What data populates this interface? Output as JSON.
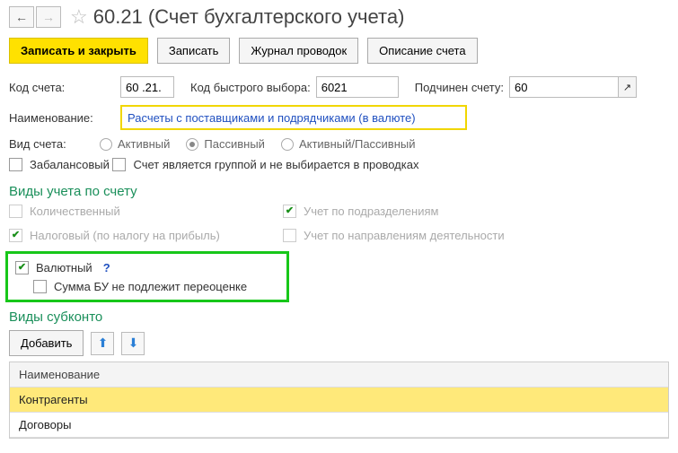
{
  "header": {
    "title": "60.21 (Счет бухгалтерского учета)"
  },
  "toolbar": {
    "save_close": "Записать и закрыть",
    "save": "Записать",
    "journal": "Журнал проводок",
    "descr": "Описание счета"
  },
  "labels": {
    "code": "Код счета:",
    "fast_code": "Код быстрого выбора:",
    "parent": "Подчинен счету:",
    "name": "Наименование:",
    "view": "Вид счета:"
  },
  "values": {
    "code": "60 .21.",
    "fast_code": "6021",
    "parent": "60",
    "name": "Расчеты с поставщиками и подрядчиками (в валюте)"
  },
  "view_options": {
    "active": "Активный",
    "passive": "Пассивный",
    "both": "Активный/Пассивный"
  },
  "checks_top": {
    "offbalance": "Забалансовый",
    "is_group": "Счет является группой и не выбирается в проводках"
  },
  "section_types": "Виды учета по счету",
  "type_checks": {
    "qty": "Количественный",
    "tax": "Налоговый (по налогу на прибыль)",
    "dept": "Учет по подразделениям",
    "activity": "Учет по направлениям деятельности",
    "currency": "Валютный",
    "no_reval": "Сумма БУ не подлежит переоценке"
  },
  "help_q": "?",
  "section_subconto": "Виды субконто",
  "sub_toolbar": {
    "add": "Добавить"
  },
  "subconto_table": {
    "header": "Наименование",
    "rows": [
      "Контрагенты",
      "Договоры"
    ]
  }
}
